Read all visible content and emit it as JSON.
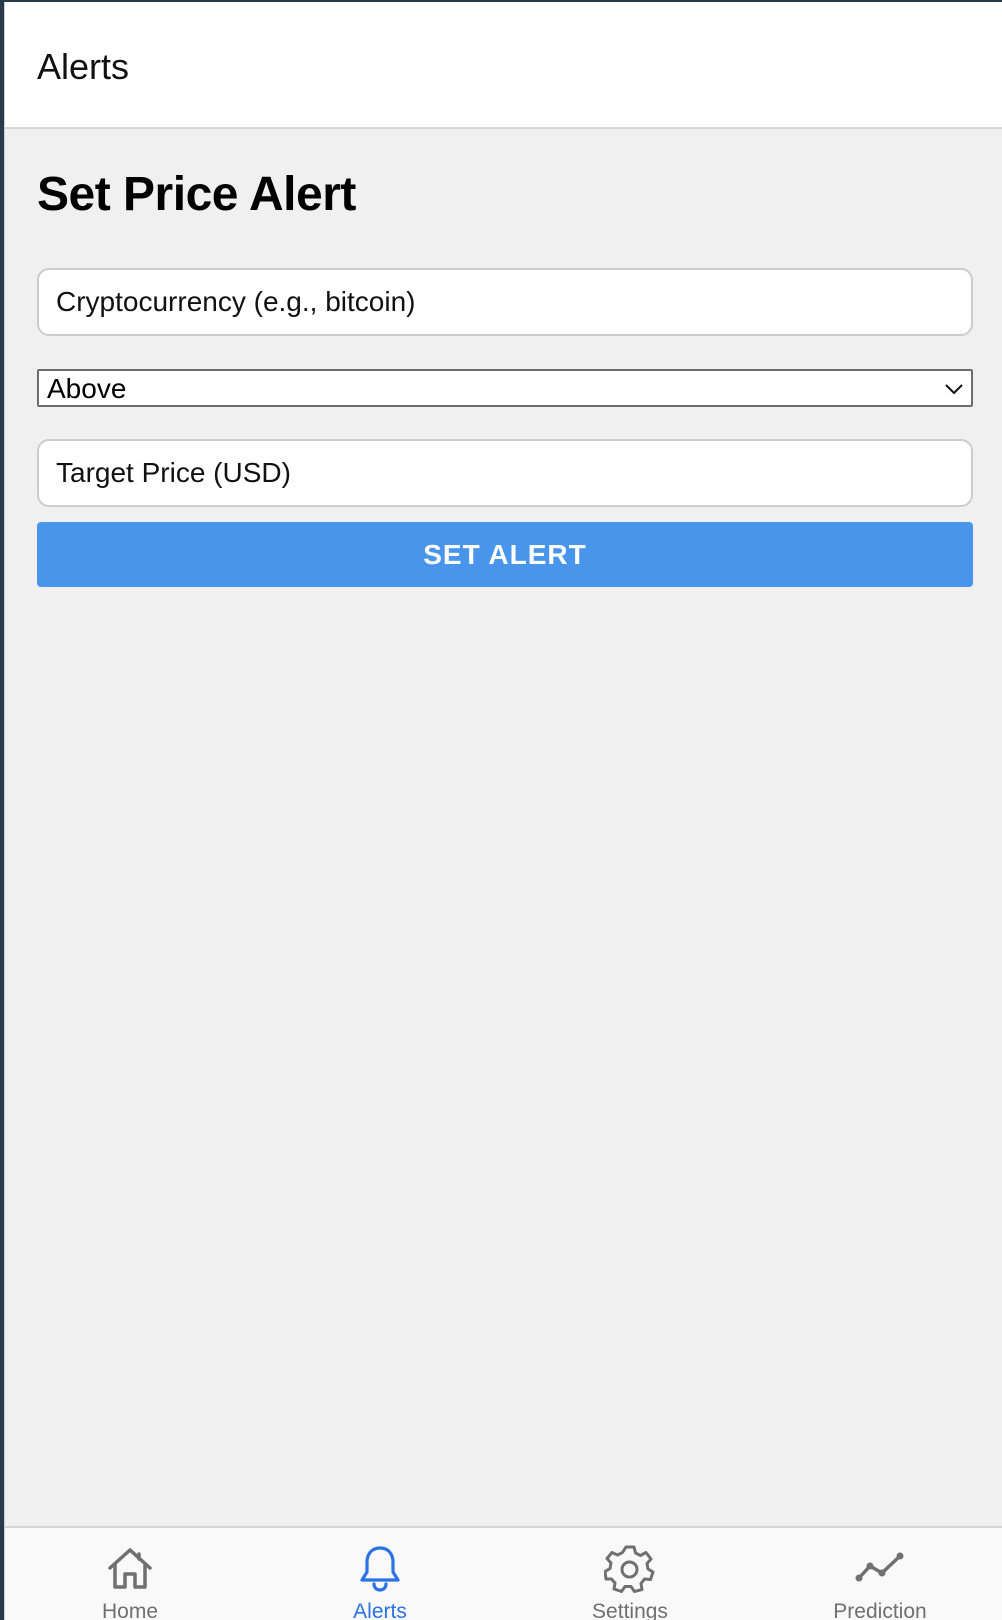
{
  "header": {
    "title": "Alerts"
  },
  "main": {
    "page_title": "Set Price Alert",
    "crypto_input": {
      "placeholder": "Cryptocurrency (e.g., bitcoin)",
      "value": ""
    },
    "condition_select": {
      "selected": "Above"
    },
    "price_input": {
      "placeholder": "Target Price (USD)",
      "value": ""
    },
    "submit_label": "SET ALERT"
  },
  "tabs": [
    {
      "label": "Home",
      "icon": "home-icon",
      "active": false
    },
    {
      "label": "Alerts",
      "icon": "bell-icon",
      "active": true
    },
    {
      "label": "Settings",
      "icon": "gear-icon",
      "active": false
    },
    {
      "label": "Prediction",
      "icon": "trend-line-icon",
      "active": false
    }
  ],
  "colors": {
    "accent": "#4a95ec",
    "active_tab": "#2a73e6",
    "inactive_tab": "#707070",
    "background": "#f0f0f0"
  }
}
